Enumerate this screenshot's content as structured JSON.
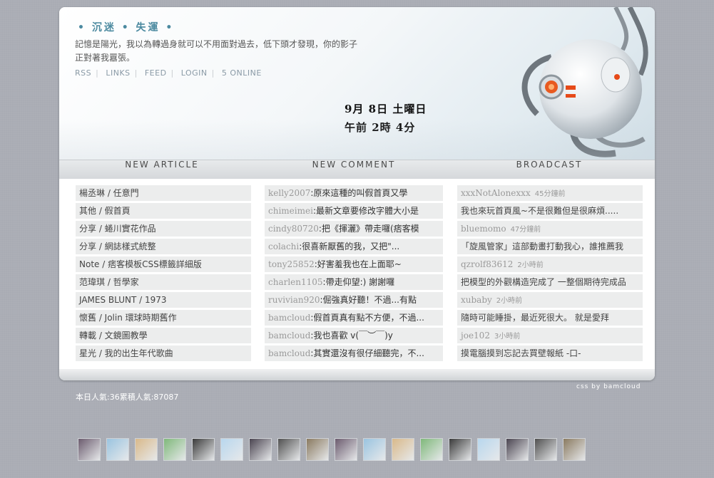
{
  "header": {
    "title": "• 沉迷 • 失運 •",
    "description": "記憶是陽光，我以為轉過身就可以不用面對過去，低下頭才發現，你的影子正對著我囂張。",
    "nav": [
      "RSS",
      "LINKS",
      "FEED",
      "LOGIN",
      "5 ONLINE"
    ],
    "clock_date": "9月 8日 土曜日",
    "clock_time": "午前 2時 4分"
  },
  "sections": {
    "articles_title": "NEW ARTICLE",
    "comments_title": "NEW COMMENT",
    "broadcast_title": "BROADCAST"
  },
  "articles": [
    "楊丞琳 / 任意門",
    "其他 / 假首頁",
    "分享 / 蜷川實花作品",
    "分享 / 網誌樣式統整",
    "Note / 痞客模板CSS標籤詳細版",
    "范瑋琪 / 哲學家",
    "JAMES BLUNT / 1973",
    "懷舊 / Jolin 環球時期舊作",
    "轉載 / 文鏡圖教學",
    "星光 / 我的出生年代歌曲"
  ],
  "comments": [
    {
      "user": "kelly2007",
      "msg": ":原來這種的叫假首頁又學"
    },
    {
      "user": "chimeimei",
      "msg": ":最新文章要修改字體大小是"
    },
    {
      "user": "cindy80720",
      "msg": ":把《揮灑》帶走囉(痞客模"
    },
    {
      "user": "colachi",
      "msg": ":很喜新厭舊的我，又把\"..."
    },
    {
      "user": "tony25852",
      "msg": ":好害羞我也在上面耶~"
    },
    {
      "user": "charlen1105",
      "msg": ":帶走仰望:) 謝謝囉"
    },
    {
      "user": "ruvivian920",
      "msg": ":倔強真好聽！不過...有點"
    },
    {
      "user": "bamcloud",
      "msg": ":假首頁真有點不方便，不過..."
    },
    {
      "user": "bamcloud",
      "msg": ":我也喜歡 v(￣︶￣)y"
    },
    {
      "user": "bamcloud",
      "msg": ":其實還沒有很仔細聽完，不..."
    }
  ],
  "broadcast": [
    {
      "user": "xxxNotAlonexxx",
      "time": "45分鐘前",
      "msg": "我也來玩首頁風~不是很難但是很麻煩....."
    },
    {
      "user": "bluemomo",
      "time": "47分鐘前",
      "msg": "「旋風管家」這部動畫打動我心，誰推薦我"
    },
    {
      "user": "qzrolf83612",
      "time": "2小時前",
      "msg": "把模型的外觀構造完成了 一整個期待完成品"
    },
    {
      "user": "xubaby",
      "time": "2小時前",
      "msg": "隨時可能睡掛，最近死很大。   就是愛拜"
    },
    {
      "user": "joe102",
      "time": "3小時前",
      "msg": "摸電腦摸到忘記去買壁報紙 -口-"
    }
  ],
  "footer": {
    "credit": "css by bamcloud",
    "stats": "本日人氣:36累積人氣:87087"
  },
  "thumb_colors": [
    "#6b5b6e",
    "#9ac4e0",
    "#d9b98a",
    "#7fb87a",
    "#3a3a3a",
    "#b8d7ee",
    "#4a4450",
    "#505050",
    "#8a7a60",
    "#6b5b6e",
    "#9ac4e0",
    "#d9b98a",
    "#7fb87a",
    "#3a3a3a",
    "#b8d7ee",
    "#4a4450",
    "#505050",
    "#8a7a60"
  ]
}
